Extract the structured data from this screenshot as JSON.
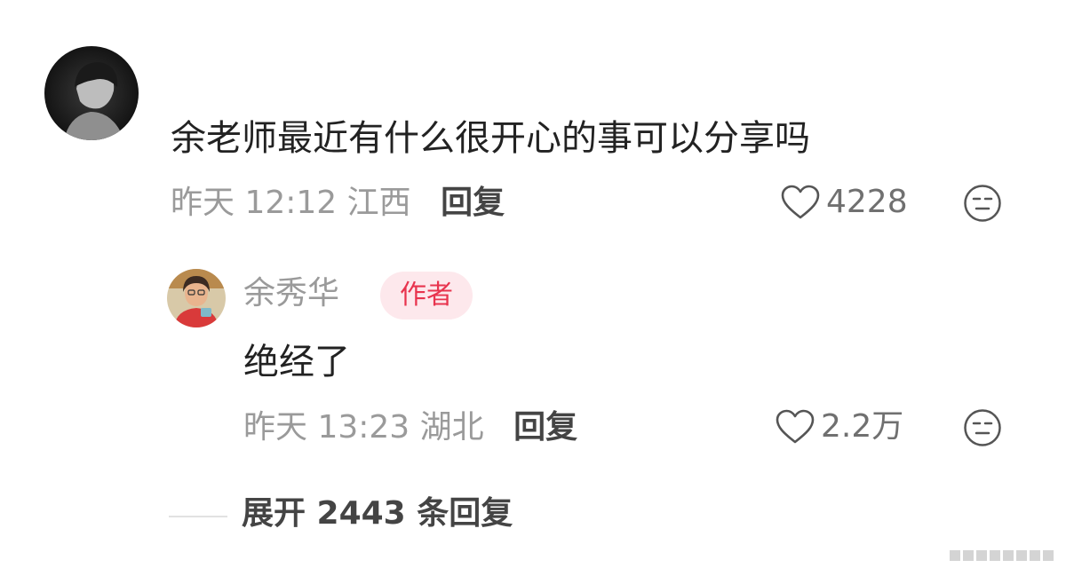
{
  "comment": {
    "text": "余老师最近有什么很开心的事可以分享吗",
    "time": "昨天 12:12",
    "location": "江西",
    "reply_label": "回复",
    "likes": "4228"
  },
  "reply": {
    "username": "余秀华",
    "badge": "作者",
    "text": "绝经了",
    "time": "昨天 13:23",
    "location": "湖北",
    "reply_label": "回复",
    "likes": "2.2万"
  },
  "expand": {
    "label": "展开 2443 条回复"
  },
  "icons": {
    "like": "heart-outline-icon",
    "dislike": "neutral-face-icon"
  },
  "colors": {
    "badge_text": "#e8344e",
    "badge_bg": "#fde8ec",
    "meta_gray": "#9a9a9a"
  }
}
